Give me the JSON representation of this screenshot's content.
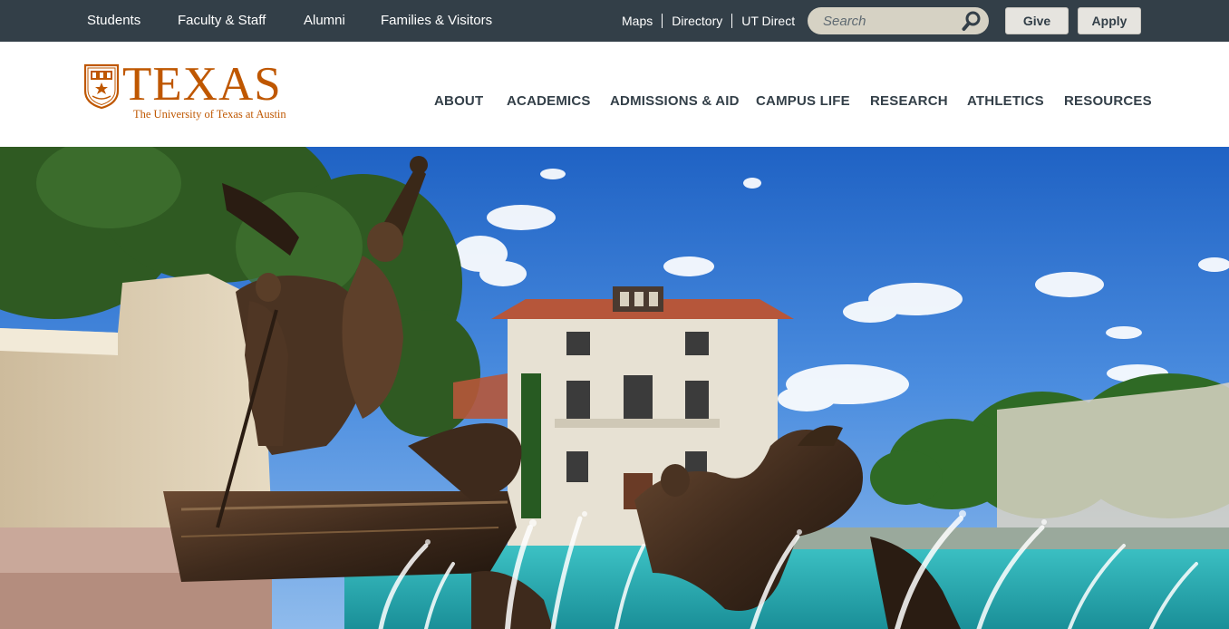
{
  "utility_bar": {
    "audience_links": [
      "Students",
      "Faculty & Staff",
      "Alumni",
      "Families & Visitors"
    ],
    "quick_links": [
      "Maps",
      "Directory",
      "UT Direct"
    ],
    "search": {
      "placeholder": "Search"
    },
    "give_label": "Give",
    "apply_label": "Apply"
  },
  "header": {
    "logo": {
      "wordmark": "TEXAS",
      "tagline": "The University of Texas at Austin"
    },
    "nav": [
      "ABOUT",
      "ACADEMICS",
      "ADMISSIONS & AID",
      "CAMPUS LIFE",
      "RESEARCH",
      "ATHLETICS",
      "RESOURCES"
    ]
  },
  "hero": {
    "scene": "Littlefield Fountain bronze sculpture in front of campus building under blue sky"
  },
  "colors": {
    "burnt_orange": "#bf5700",
    "charcoal": "#333f48",
    "search_bg": "#d6d2c4",
    "hero_sky": "#3a7ad6"
  }
}
